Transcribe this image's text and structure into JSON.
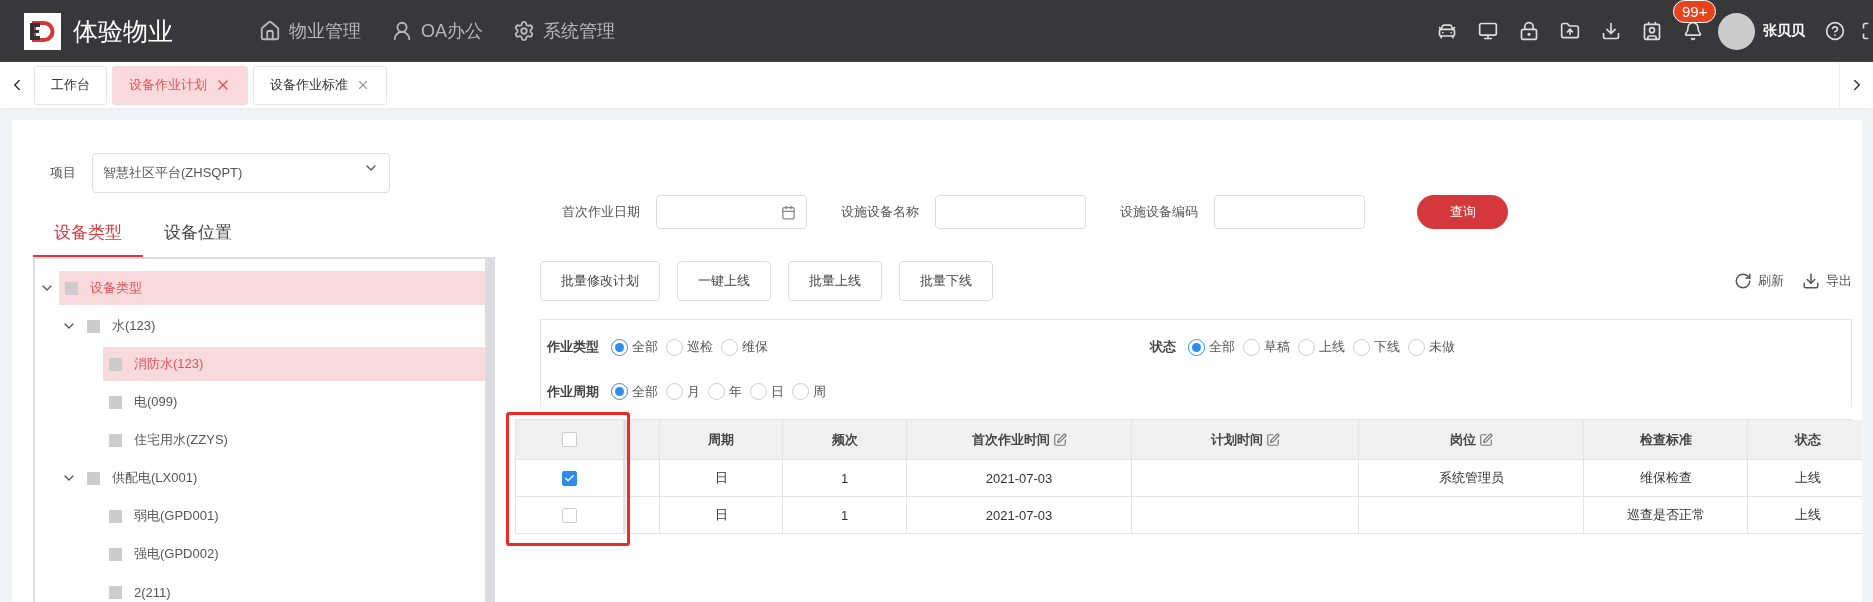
{
  "header": {
    "app_title": "体验物业",
    "nav": [
      {
        "kind": "home",
        "label": "物业管理"
      },
      {
        "kind": "user",
        "label": "OA办公"
      },
      {
        "kind": "gear",
        "label": "系统管理"
      }
    ],
    "badge": "99+",
    "user_name": "张贝贝"
  },
  "tabs": [
    {
      "label": "工作台",
      "selected": false,
      "closable": false
    },
    {
      "label": "设备作业计划",
      "selected": true,
      "closable": true
    },
    {
      "label": "设备作业标准",
      "selected": false,
      "closable": true
    }
  ],
  "project": {
    "label": "项目",
    "value": "智慧社区平台(ZHSQPT)"
  },
  "tree_tabs": [
    {
      "label": "设备类型",
      "selected": true
    },
    {
      "label": "设备位置",
      "selected": false
    }
  ],
  "tree": [
    {
      "label": "设备类型",
      "selected": true,
      "expanded": true,
      "children": [
        {
          "label": "水(123)",
          "selected": false,
          "expanded": true,
          "children": [
            {
              "label": "消防水(123)",
              "selected": true
            },
            {
              "label": "电(099)",
              "selected": false
            },
            {
              "label": "住宅用水(ZZYS)",
              "selected": false
            }
          ]
        },
        {
          "label": "供配电(LX001)",
          "selected": false,
          "expanded": true,
          "children": [
            {
              "label": "弱电(GPD001)",
              "selected": false
            },
            {
              "label": "强电(GPD002)",
              "selected": false
            },
            {
              "label": "2(211)",
              "selected": false
            }
          ]
        }
      ]
    }
  ],
  "filters": [
    {
      "kind": "date",
      "label": "首次作业日期"
    },
    {
      "kind": "text",
      "label": "设施设备名称"
    },
    {
      "kind": "text",
      "label": "设施设备编码"
    }
  ],
  "query_button": "查询",
  "actions": [
    "批量修改计划",
    "一键上线",
    "批量上线",
    "批量下线"
  ],
  "tools": [
    {
      "kind": "refresh",
      "label": "刷新"
    },
    {
      "kind": "export",
      "label": "导出"
    }
  ],
  "radio_groups": [
    {
      "label": "作业类型",
      "options": [
        {
          "label": "全部",
          "selected": true
        },
        {
          "label": "巡检",
          "selected": false
        },
        {
          "label": "维保",
          "selected": false
        }
      ]
    },
    {
      "label": "状态",
      "options": [
        {
          "label": "全部",
          "selected": true
        },
        {
          "label": "草稿",
          "selected": false
        },
        {
          "label": "上线",
          "selected": false
        },
        {
          "label": "下线",
          "selected": false
        },
        {
          "label": "未做",
          "selected": false
        }
      ]
    },
    {
      "label": "作业周期",
      "options": [
        {
          "label": "全部",
          "selected": true
        },
        {
          "label": "月",
          "selected": false
        },
        {
          "label": "年",
          "selected": false
        },
        {
          "label": "日",
          "selected": false
        },
        {
          "label": "周",
          "selected": false
        }
      ]
    }
  ],
  "table": {
    "all_checked": false,
    "columns": [
      {
        "label": "周期",
        "editable": false
      },
      {
        "label": "频次",
        "editable": false
      },
      {
        "label": "首次作业时间",
        "editable": true
      },
      {
        "label": "计划时间",
        "editable": true
      },
      {
        "label": "岗位",
        "editable": true
      },
      {
        "label": "检查标准",
        "editable": false
      },
      {
        "label": "状态",
        "editable": false
      }
    ],
    "rows": [
      {
        "selected": true,
        "cells": [
          "日",
          "1",
          "2021-07-03",
          "",
          "系统管理员",
          "维保检查",
          "上线"
        ]
      },
      {
        "selected": false,
        "cells": [
          "日",
          "1",
          "2021-07-03",
          "",
          "",
          "巡查是否正常",
          "上线"
        ]
      }
    ]
  }
}
